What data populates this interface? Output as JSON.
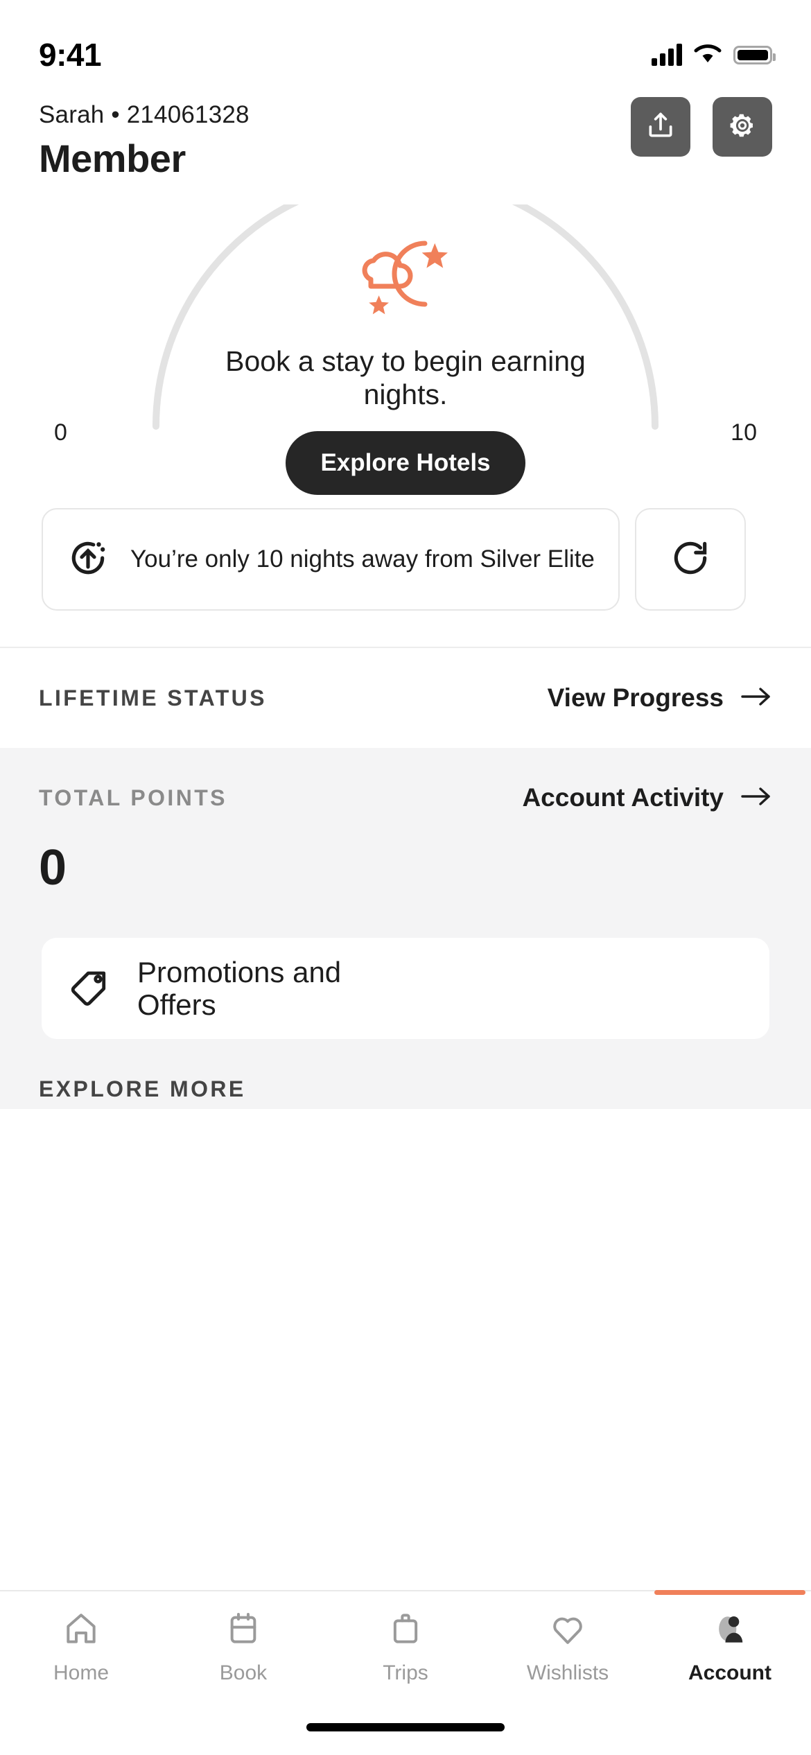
{
  "status_bar": {
    "time": "9:41",
    "signal_icon": "cellular-signal-icon",
    "wifi_icon": "wifi-icon",
    "battery_icon": "battery-icon"
  },
  "header": {
    "member_line": "Sarah • 214061328",
    "tier_title": "Member",
    "share_button": "share-button",
    "settings_button": "settings-button"
  },
  "progress": {
    "min_label": "0",
    "max_label": "10",
    "illustration": "moon-cloud-stars-icon",
    "message": "Book a stay to begin earning nights.",
    "cta_label": "Explore Hotels",
    "accent_color": "#F0805A",
    "track_color": "#E3E3E3"
  },
  "notifications": [
    {
      "icon": "arrow-up-progress-icon",
      "text": "You’re only 10 nights away from Silver Elite"
    },
    {
      "icon": "refresh-icon",
      "text": ""
    }
  ],
  "sections": [
    {
      "label": "LIFETIME STATUS",
      "link_text": "View Progress",
      "link_icon": "arrow-right-icon"
    },
    {
      "label": "TOTAL POINTS",
      "link_text": "Account Activity",
      "link_icon": "arrow-right-icon"
    }
  ],
  "points": {
    "value": "0"
  },
  "promotions": {
    "icon": "tag-icon",
    "label": "Promotions and Offers"
  },
  "explore_more": {
    "label": "EXPLORE MORE"
  },
  "tabbar": {
    "items": [
      {
        "label": "Home",
        "icon": "house-icon",
        "active": false
      },
      {
        "label": "Book",
        "icon": "calendar-icon",
        "active": false
      },
      {
        "label": "Trips",
        "icon": "briefcase-icon",
        "active": false
      },
      {
        "label": "Wishlists",
        "icon": "heart-icon",
        "active": false
      },
      {
        "label": "Account",
        "icon": "person-icon",
        "active": true
      }
    ]
  }
}
